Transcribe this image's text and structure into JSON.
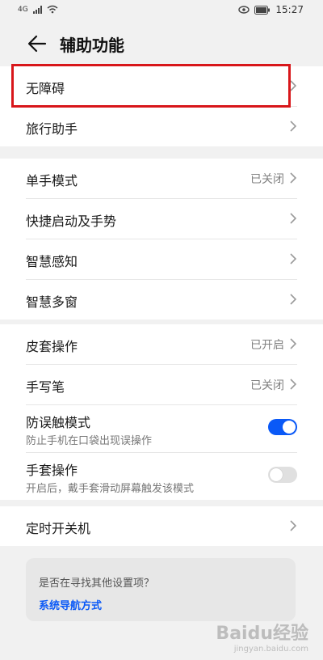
{
  "status_bar": {
    "network": "4G",
    "time": "15:27"
  },
  "header": {
    "title": "辅助功能"
  },
  "items": {
    "accessibility": "无障碍",
    "travel_assistant": "旅行助手",
    "one_hand_mode": {
      "label": "单手模式",
      "value": "已关闭"
    },
    "shortcuts_gestures": "快捷启动及手势",
    "smart_sensing": "智慧感知",
    "smart_multiwindow": "智慧多窗",
    "cover_operation": {
      "label": "皮套操作",
      "value": "已开启"
    },
    "stylus": {
      "label": "手写笔",
      "value": "已关闭"
    },
    "accidental_touch": {
      "label": "防误触模式",
      "sub": "防止手机在口袋出现误操作",
      "enabled": true
    },
    "glove_mode": {
      "label": "手套操作",
      "sub": "开启后，戴手套滑动屏幕触发该模式",
      "enabled": false
    },
    "scheduled_power": "定时开关机"
  },
  "hint": {
    "question": "是否在寻找其他设置项？",
    "link": "系统导航方式"
  },
  "watermark": {
    "line1": "Baidu经验",
    "line2": "jingyan.baidu.com"
  },
  "colors": {
    "accent": "#0a59f7",
    "highlight": "#d8161a"
  }
}
